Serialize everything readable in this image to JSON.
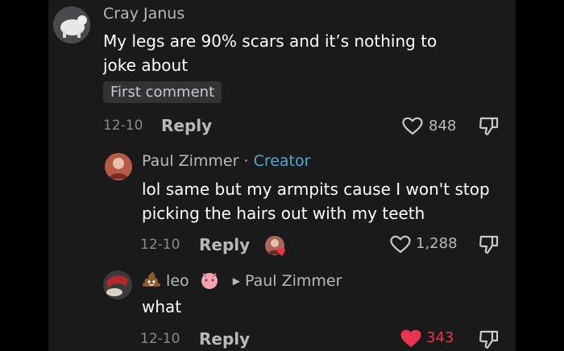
{
  "comments": [
    {
      "author": "Cray Janus",
      "text": "My legs are 90% scars and it’s nothing to joke about",
      "badge": "First comment",
      "date": "12-10",
      "reply_label": "Reply",
      "likes": "848",
      "liked": false
    },
    {
      "author": "Paul Zimmer",
      "separator": "·",
      "creator_label": "Creator",
      "text": "lol same but my armpits cause I won't stop picking the hairs out with my teeth",
      "date": "12-10",
      "reply_label": "Reply",
      "likes": "1,288",
      "liked": false
    },
    {
      "author": "leo",
      "reply_to": "Paul Zimmer",
      "text": "what",
      "date": "12-10",
      "reply_label": "Reply",
      "likes": "343",
      "liked": true
    }
  ],
  "colors": {
    "background": "#1a1a1b",
    "liked_heart": "#e8344e",
    "creator": "#4fa9d6"
  },
  "icons": {
    "like": "heart-icon",
    "dislike": "thumbs-down-icon",
    "reply_to": "triangle-right-icon",
    "emoji_leading": "poop-emoji-icon",
    "emoji_trailing": "pink-face-emoji-icon"
  }
}
